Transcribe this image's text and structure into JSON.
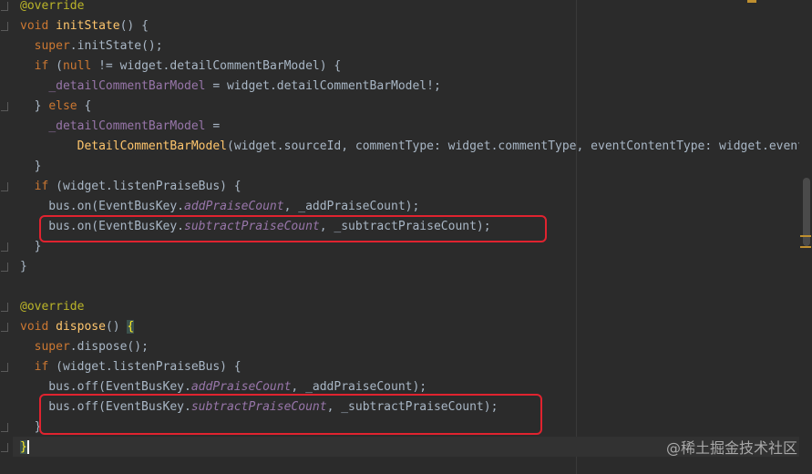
{
  "editor": {
    "lines": [
      [
        {
          "t": "@override",
          "c": "tok-anno"
        }
      ],
      [
        {
          "t": "void ",
          "c": "tok-kw"
        },
        {
          "t": "initState",
          "c": "tok-fn"
        },
        {
          "t": "() {",
          "c": "tok-plain"
        }
      ],
      [
        {
          "t": "  "
        },
        {
          "t": "super",
          "c": "tok-kw"
        },
        {
          "t": ".initState();",
          "c": "tok-plain"
        }
      ],
      [
        {
          "t": "  "
        },
        {
          "t": "if ",
          "c": "tok-kw"
        },
        {
          "t": "(",
          "c": "tok-plain"
        },
        {
          "t": "null",
          "c": "tok-kw"
        },
        {
          "t": " != widget.detailCommentBarModel) {",
          "c": "tok-plain"
        }
      ],
      [
        {
          "t": "    "
        },
        {
          "t": "_detailCommentBarModel",
          "c": "tok-field"
        },
        {
          "t": " = widget.detailCommentBarModel!;",
          "c": "tok-plain"
        }
      ],
      [
        {
          "t": "  } "
        },
        {
          "t": "else",
          "c": "tok-kw"
        },
        {
          "t": " {",
          "c": "tok-plain"
        }
      ],
      [
        {
          "t": "    "
        },
        {
          "t": "_detailCommentBarModel",
          "c": "tok-field"
        },
        {
          "t": " =",
          "c": "tok-plain"
        }
      ],
      [
        {
          "t": "        "
        },
        {
          "t": "DetailCommentBarModel",
          "c": "tok-fn"
        },
        {
          "t": "(widget.sourceId, commentType: widget.commentType, eventContentType: widget.eventC",
          "c": "tok-plain"
        }
      ],
      [
        {
          "t": "  }"
        }
      ],
      [
        {
          "t": "  "
        },
        {
          "t": "if ",
          "c": "tok-kw"
        },
        {
          "t": "(widget.listenPraiseBus) {",
          "c": "tok-plain"
        }
      ],
      [
        {
          "t": "    bus.on(EventBusKey."
        },
        {
          "t": "addPraiseCount",
          "c": "tok-field tok-it"
        },
        {
          "t": ", _addPraiseCount);",
          "c": "tok-plain"
        }
      ],
      [
        {
          "t": "    bus.on(EventBusKey."
        },
        {
          "t": "subtractPraiseCount",
          "c": "tok-field tok-it"
        },
        {
          "t": ", _subtractPraiseCount);",
          "c": "tok-plain"
        }
      ],
      [
        {
          "t": "  }"
        }
      ],
      [
        {
          "t": "}"
        }
      ],
      [
        {
          "t": ""
        }
      ],
      [
        {
          "t": "@override",
          "c": "tok-anno"
        }
      ],
      [
        {
          "t": "void ",
          "c": "tok-kw"
        },
        {
          "t": "dispose",
          "c": "tok-fn"
        },
        {
          "t": "() ",
          "c": "tok-plain"
        },
        {
          "t": "{",
          "c": "brace-hl"
        }
      ],
      [
        {
          "t": "  "
        },
        {
          "t": "super",
          "c": "tok-kw"
        },
        {
          "t": ".dispose();",
          "c": "tok-plain"
        }
      ],
      [
        {
          "t": "  "
        },
        {
          "t": "if ",
          "c": "tok-kw"
        },
        {
          "t": "(widget.listenPraiseBus) {",
          "c": "tok-plain"
        }
      ],
      [
        {
          "t": "    bus.off(EventBusKey."
        },
        {
          "t": "addPraiseCount",
          "c": "tok-field tok-it"
        },
        {
          "t": ", _addPraiseCount);",
          "c": "tok-plain"
        }
      ],
      [
        {
          "t": "    bus.off(EventBusKey."
        },
        {
          "t": "subtractPraiseCount",
          "c": "tok-field tok-it"
        },
        {
          "t": ", _subtractPraiseCount);",
          "c": "tok-plain"
        }
      ],
      [
        {
          "t": "  }"
        }
      ],
      [
        {
          "t": "}",
          "c": "brace-hl2"
        }
      ]
    ]
  },
  "watermark": "@稀土掘金技术社区",
  "colors": {
    "background": "#2b2b2b",
    "keyword": "#cc7832",
    "annotation": "#bbb529",
    "function": "#ffc66d",
    "field": "#9876aa",
    "text": "#a9b7c6",
    "highlight_box": "#e0232f"
  }
}
